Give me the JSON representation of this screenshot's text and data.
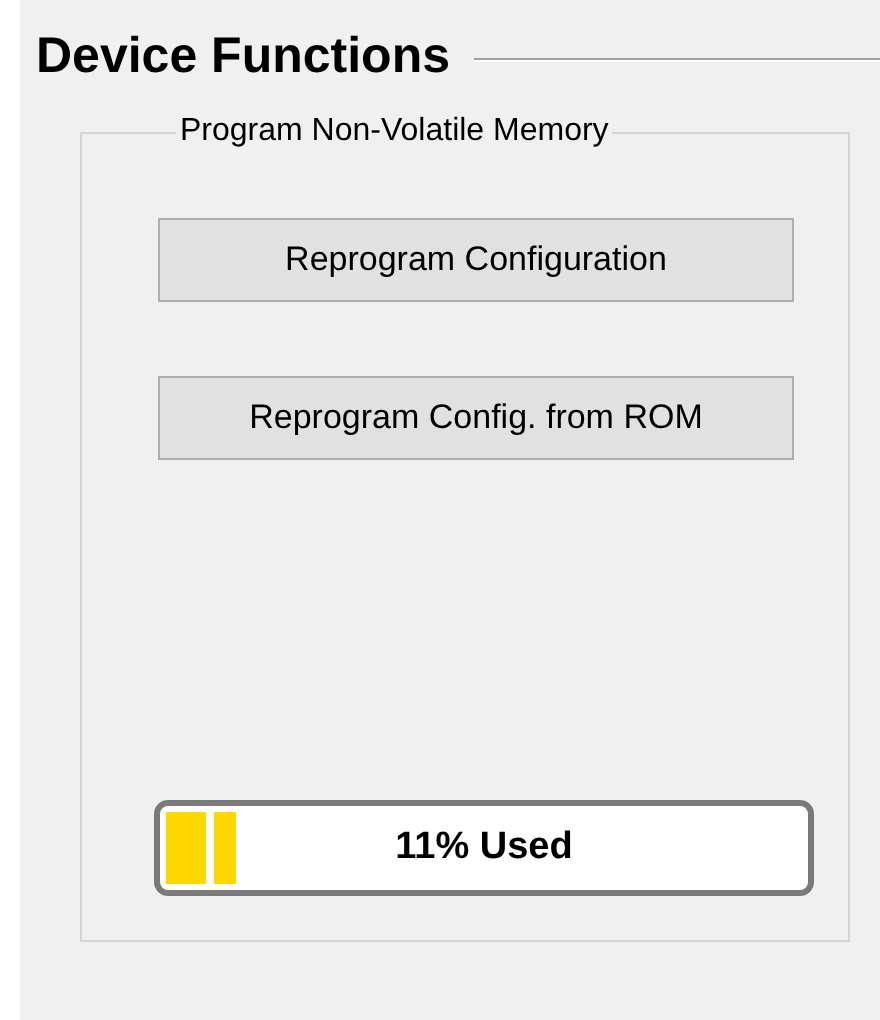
{
  "title": "Device Functions",
  "group": {
    "title": "Program Non-Volatile Memory",
    "buttons": [
      "Reprogram Configuration",
      "Reprogram Config. from ROM"
    ],
    "memory": {
      "level": 0.11,
      "label": "11% Used"
    }
  }
}
